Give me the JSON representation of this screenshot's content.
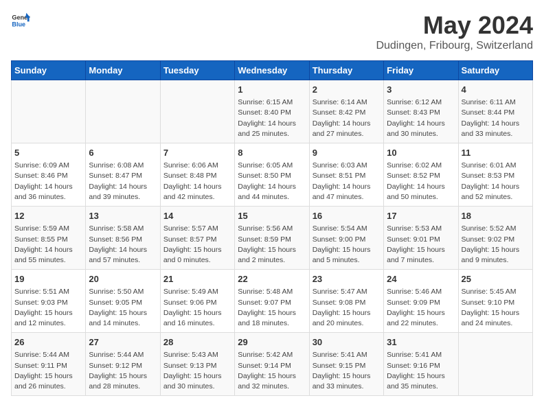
{
  "header": {
    "logo_general": "General",
    "logo_blue": "Blue",
    "main_title": "May 2024",
    "subtitle": "Dudingen, Fribourg, Switzerland"
  },
  "days_of_week": [
    "Sunday",
    "Monday",
    "Tuesday",
    "Wednesday",
    "Thursday",
    "Friday",
    "Saturday"
  ],
  "weeks": [
    [
      {
        "day": "",
        "info": ""
      },
      {
        "day": "",
        "info": ""
      },
      {
        "day": "",
        "info": ""
      },
      {
        "day": "1",
        "info": "Sunrise: 6:15 AM\nSunset: 8:40 PM\nDaylight: 14 hours\nand 25 minutes."
      },
      {
        "day": "2",
        "info": "Sunrise: 6:14 AM\nSunset: 8:42 PM\nDaylight: 14 hours\nand 27 minutes."
      },
      {
        "day": "3",
        "info": "Sunrise: 6:12 AM\nSunset: 8:43 PM\nDaylight: 14 hours\nand 30 minutes."
      },
      {
        "day": "4",
        "info": "Sunrise: 6:11 AM\nSunset: 8:44 PM\nDaylight: 14 hours\nand 33 minutes."
      }
    ],
    [
      {
        "day": "5",
        "info": "Sunrise: 6:09 AM\nSunset: 8:46 PM\nDaylight: 14 hours\nand 36 minutes."
      },
      {
        "day": "6",
        "info": "Sunrise: 6:08 AM\nSunset: 8:47 PM\nDaylight: 14 hours\nand 39 minutes."
      },
      {
        "day": "7",
        "info": "Sunrise: 6:06 AM\nSunset: 8:48 PM\nDaylight: 14 hours\nand 42 minutes."
      },
      {
        "day": "8",
        "info": "Sunrise: 6:05 AM\nSunset: 8:50 PM\nDaylight: 14 hours\nand 44 minutes."
      },
      {
        "day": "9",
        "info": "Sunrise: 6:03 AM\nSunset: 8:51 PM\nDaylight: 14 hours\nand 47 minutes."
      },
      {
        "day": "10",
        "info": "Sunrise: 6:02 AM\nSunset: 8:52 PM\nDaylight: 14 hours\nand 50 minutes."
      },
      {
        "day": "11",
        "info": "Sunrise: 6:01 AM\nSunset: 8:53 PM\nDaylight: 14 hours\nand 52 minutes."
      }
    ],
    [
      {
        "day": "12",
        "info": "Sunrise: 5:59 AM\nSunset: 8:55 PM\nDaylight: 14 hours\nand 55 minutes."
      },
      {
        "day": "13",
        "info": "Sunrise: 5:58 AM\nSunset: 8:56 PM\nDaylight: 14 hours\nand 57 minutes."
      },
      {
        "day": "14",
        "info": "Sunrise: 5:57 AM\nSunset: 8:57 PM\nDaylight: 15 hours\nand 0 minutes."
      },
      {
        "day": "15",
        "info": "Sunrise: 5:56 AM\nSunset: 8:59 PM\nDaylight: 15 hours\nand 2 minutes."
      },
      {
        "day": "16",
        "info": "Sunrise: 5:54 AM\nSunset: 9:00 PM\nDaylight: 15 hours\nand 5 minutes."
      },
      {
        "day": "17",
        "info": "Sunrise: 5:53 AM\nSunset: 9:01 PM\nDaylight: 15 hours\nand 7 minutes."
      },
      {
        "day": "18",
        "info": "Sunrise: 5:52 AM\nSunset: 9:02 PM\nDaylight: 15 hours\nand 9 minutes."
      }
    ],
    [
      {
        "day": "19",
        "info": "Sunrise: 5:51 AM\nSunset: 9:03 PM\nDaylight: 15 hours\nand 12 minutes."
      },
      {
        "day": "20",
        "info": "Sunrise: 5:50 AM\nSunset: 9:05 PM\nDaylight: 15 hours\nand 14 minutes."
      },
      {
        "day": "21",
        "info": "Sunrise: 5:49 AM\nSunset: 9:06 PM\nDaylight: 15 hours\nand 16 minutes."
      },
      {
        "day": "22",
        "info": "Sunrise: 5:48 AM\nSunset: 9:07 PM\nDaylight: 15 hours\nand 18 minutes."
      },
      {
        "day": "23",
        "info": "Sunrise: 5:47 AM\nSunset: 9:08 PM\nDaylight: 15 hours\nand 20 minutes."
      },
      {
        "day": "24",
        "info": "Sunrise: 5:46 AM\nSunset: 9:09 PM\nDaylight: 15 hours\nand 22 minutes."
      },
      {
        "day": "25",
        "info": "Sunrise: 5:45 AM\nSunset: 9:10 PM\nDaylight: 15 hours\nand 24 minutes."
      }
    ],
    [
      {
        "day": "26",
        "info": "Sunrise: 5:44 AM\nSunset: 9:11 PM\nDaylight: 15 hours\nand 26 minutes."
      },
      {
        "day": "27",
        "info": "Sunrise: 5:44 AM\nSunset: 9:12 PM\nDaylight: 15 hours\nand 28 minutes."
      },
      {
        "day": "28",
        "info": "Sunrise: 5:43 AM\nSunset: 9:13 PM\nDaylight: 15 hours\nand 30 minutes."
      },
      {
        "day": "29",
        "info": "Sunrise: 5:42 AM\nSunset: 9:14 PM\nDaylight: 15 hours\nand 32 minutes."
      },
      {
        "day": "30",
        "info": "Sunrise: 5:41 AM\nSunset: 9:15 PM\nDaylight: 15 hours\nand 33 minutes."
      },
      {
        "day": "31",
        "info": "Sunrise: 5:41 AM\nSunset: 9:16 PM\nDaylight: 15 hours\nand 35 minutes."
      },
      {
        "day": "",
        "info": ""
      }
    ]
  ]
}
